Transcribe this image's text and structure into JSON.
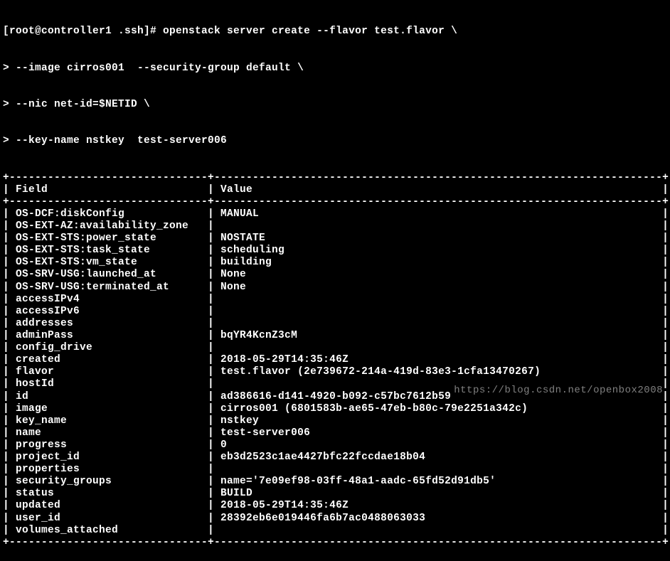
{
  "prompt": {
    "line1": "[root@controller1 .ssh]# openstack server create --flavor test.flavor \\",
    "line2": "> --image cirros001  --security-group default \\",
    "line3": "> --nic net-id=$NETID \\",
    "line4": "> --key-name nstkey  test-server006"
  },
  "table": {
    "header_field": "Field",
    "header_value": "Value",
    "rows": [
      {
        "field": "OS-DCF:diskConfig",
        "value": "MANUAL"
      },
      {
        "field": "OS-EXT-AZ:availability_zone",
        "value": ""
      },
      {
        "field": "OS-EXT-STS:power_state",
        "value": "NOSTATE"
      },
      {
        "field": "OS-EXT-STS:task_state",
        "value": "scheduling"
      },
      {
        "field": "OS-EXT-STS:vm_state",
        "value": "building"
      },
      {
        "field": "OS-SRV-USG:launched_at",
        "value": "None"
      },
      {
        "field": "OS-SRV-USG:terminated_at",
        "value": "None"
      },
      {
        "field": "accessIPv4",
        "value": ""
      },
      {
        "field": "accessIPv6",
        "value": ""
      },
      {
        "field": "addresses",
        "value": ""
      },
      {
        "field": "adminPass",
        "value": "bqYR4KcnZ3cM"
      },
      {
        "field": "config_drive",
        "value": ""
      },
      {
        "field": "created",
        "value": "2018-05-29T14:35:46Z"
      },
      {
        "field": "flavor",
        "value": "test.flavor (2e739672-214a-419d-83e3-1cfa13470267)"
      },
      {
        "field": "hostId",
        "value": ""
      },
      {
        "field": "id",
        "value": "ad386616-d141-4920-b092-c57bc7612b59"
      },
      {
        "field": "image",
        "value": "cirros001 (6801583b-ae65-47eb-b80c-79e2251a342c)"
      },
      {
        "field": "key_name",
        "value": "nstkey"
      },
      {
        "field": "name",
        "value": "test-server006"
      },
      {
        "field": "progress",
        "value": "0"
      },
      {
        "field": "project_id",
        "value": "eb3d2523c1ae4427bfc22fccdae18b04"
      },
      {
        "field": "properties",
        "value": ""
      },
      {
        "field": "security_groups",
        "value": "name='7e09ef98-03ff-48a1-aadc-65fd52d91db5'"
      },
      {
        "field": "status",
        "value": "BUILD"
      },
      {
        "field": "updated",
        "value": "2018-05-29T14:35:46Z"
      },
      {
        "field": "user_id",
        "value": "28392eb6e019446fa6b7ac0488063033"
      },
      {
        "field": "volumes_attached",
        "value": ""
      }
    ]
  },
  "watermark": "https://blog.csdn.net/openbox2008",
  "layout": {
    "field_width": 29,
    "value_width": 68
  }
}
